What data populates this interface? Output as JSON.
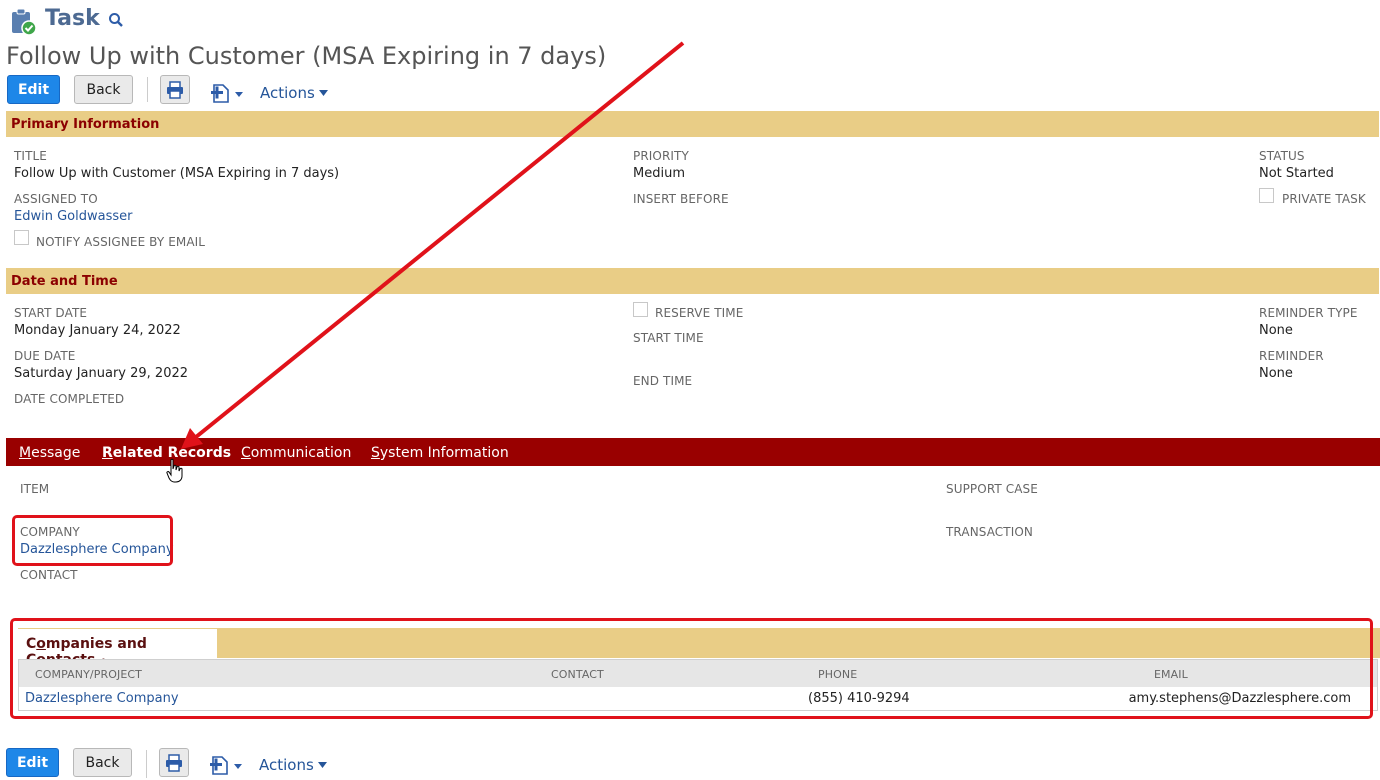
{
  "header": {
    "record_type": "Task",
    "record_title": "Follow Up with Customer (MSA Expiring in 7 days)"
  },
  "toolbar": {
    "edit": "Edit",
    "back": "Back",
    "actions": "Actions"
  },
  "primary": {
    "section_title": "Primary Information",
    "title_label": "TITLE",
    "title_value": "Follow Up with Customer (MSA Expiring in 7 days)",
    "assigned_label": "ASSIGNED TO",
    "assigned_value": "Edwin Goldwasser",
    "notify_label": "NOTIFY ASSIGNEE BY EMAIL",
    "priority_label": "PRIORITY",
    "priority_value": "Medium",
    "insert_before_label": "INSERT BEFORE",
    "status_label": "STATUS",
    "status_value": "Not Started",
    "private_label": "PRIVATE TASK"
  },
  "datetime": {
    "section_title": "Date and Time",
    "start_date_label": "START DATE",
    "start_date_value": "Monday January 24, 2022",
    "due_date_label": "DUE DATE",
    "due_date_value": "Saturday January 29, 2022",
    "date_completed_label": "DATE COMPLETED",
    "reserve_time_label": "RESERVE TIME",
    "start_time_label": "START TIME",
    "end_time_label": "END TIME",
    "reminder_type_label": "REMINDER TYPE",
    "reminder_type_value": "None",
    "reminder_label": "REMINDER",
    "reminder_value": "None"
  },
  "tabs": [
    {
      "first": "M",
      "rest": "essage"
    },
    {
      "first": "R",
      "rest": "elated Records"
    },
    {
      "first": "C",
      "rest": "ommunication"
    },
    {
      "first": "S",
      "rest": "ystem Information"
    }
  ],
  "related": {
    "item_label": "ITEM",
    "company_label": "COMPANY",
    "company_value": "Dazzlesphere Company",
    "contact_label": "CONTACT",
    "support_case_label": "SUPPORT CASE",
    "transaction_label": "TRANSACTION"
  },
  "subtab": {
    "title_first": "C",
    "title_underlined": "o",
    "title_rest": "mpanies and Contacts",
    "bullet": "•",
    "columns": [
      "COMPANY/PROJECT",
      "CONTACT",
      "PHONE",
      "EMAIL"
    ],
    "rows": [
      {
        "company": "Dazzlesphere Company",
        "contact": "",
        "phone": "(855) 410-9294",
        "email": "amy.stephens@Dazzlesphere.com"
      }
    ]
  },
  "colors": {
    "accent_blue": "#1e87e8",
    "section_bar": "#e9cd86",
    "tab_bar": "#990000",
    "annotation_red": "#e0121a"
  }
}
